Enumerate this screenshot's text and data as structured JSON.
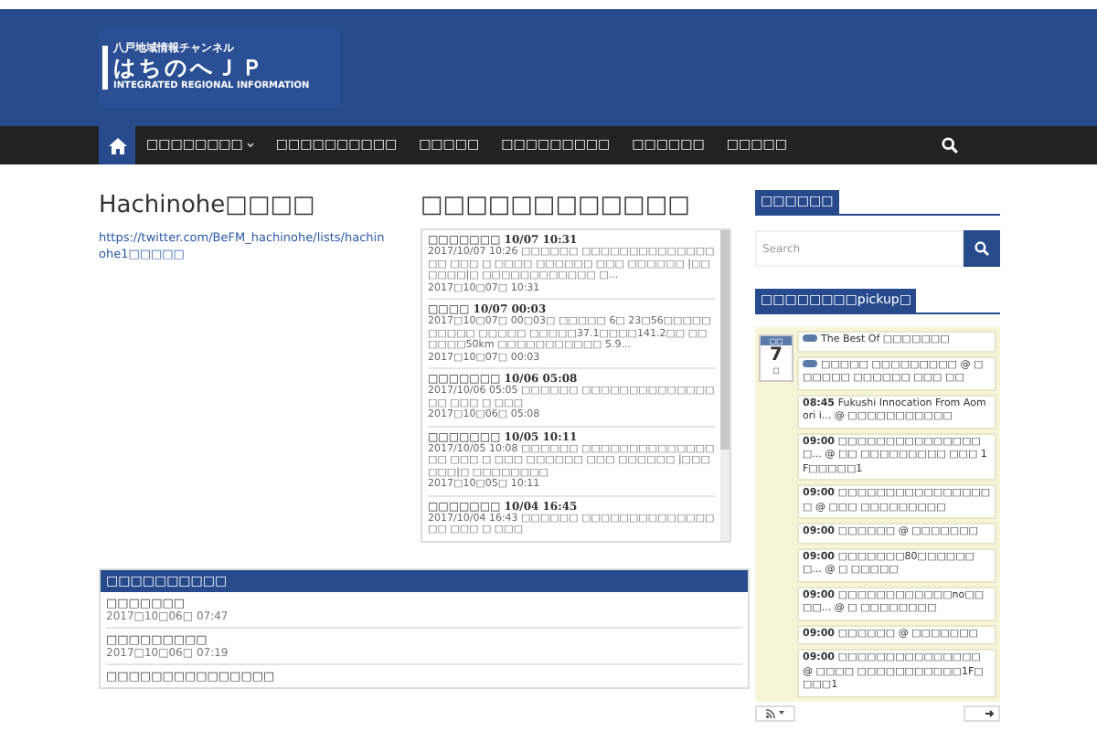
{
  "logo": {
    "tagline": "八戸地域情報チャンネル",
    "name": "はちのへＪＰ",
    "subtitle": "INTEGRATED REGIONAL INFORMATION"
  },
  "nav": {
    "items": [
      {
        "label": "□□□□□□□□",
        "has_submenu": true
      },
      {
        "label": "□□□□□□□□□□",
        "has_submenu": false
      },
      {
        "label": "□□□□□",
        "has_submenu": false
      },
      {
        "label": "□□□□□□□□□",
        "has_submenu": false
      },
      {
        "label": "□□□□□□",
        "has_submenu": false
      },
      {
        "label": "□□□□□",
        "has_submenu": false
      }
    ]
  },
  "twitter": {
    "title": "Hachinohe□□□□",
    "link": "https://twitter.com/BeFM_hachinohe/lists/hachinohe1□□□□□"
  },
  "feed": {
    "title": "□□□□□□□□□□□□",
    "entries": [
      {
        "heading": "□□□□□□□ 10/07 10:31",
        "body": "2017/10/07 10:26 □□□□□□ □□□□□□□□□□□□□□□□ □□□ □ □□□□ □□□□□□ □□□ □□□□□□ |□□□□□□|□ □□□□□□□□□□□□ □...",
        "date": "2017□10□07□ 10:31"
      },
      {
        "heading": "□□□□ 10/07 00:03",
        "body": "2017□10□07□ 00□03□ □□□□□ 6□ 23□56□□□□□□□□□□ □□□□□ □□□□□37.1□□□□141.2□□ □□□□□□50km □□□□□□□□□□□ 5.9...",
        "date": "2017□10□07□ 00:03"
      },
      {
        "heading": "□□□□□□□ 10/06 05:08",
        "body": "2017/10/06 05:05 □□□□□□ □□□□□□□□□□□□□□□□ □□□ □ □□□",
        "date": "2017□10□06□ 05:08"
      },
      {
        "heading": "□□□□□□□ 10/05 10:11",
        "body": "2017/10/05 10:08 □□□□□□ □□□□□□□□□□□□□□□□ □□□ □ □□□ □□□□□□ □□□ □□□□□□ |□□□□□□|□ □□□□□□□□",
        "date": "2017□10□05□ 10:11"
      },
      {
        "heading": "□□□□□□□ 10/04 16:45",
        "body": "2017/10/04 16:43 □□□□□□ □□□□□□□□□□□□□□□□ □□□ □ □□□"
      }
    ]
  },
  "news": {
    "title": "□□□□□□□□□□",
    "items": [
      {
        "title": "□□□□□□□",
        "date": "2017□10□06□ 07:47"
      },
      {
        "title": "□□□□□□□□□",
        "date": "2017□10□06□ 07:19"
      },
      {
        "title": "□□□□□□□□□□□□□□□"
      }
    ]
  },
  "search": {
    "title": "□□□□□□",
    "placeholder": "Search"
  },
  "calendar": {
    "title": "□□□□□□□□pickup□",
    "date": {
      "month": "□□",
      "day": "7",
      "weekday": "□"
    },
    "events": [
      {
        "kind": "allday",
        "text": "The Best Of □□□□□□□"
      },
      {
        "kind": "allday",
        "text": "□□□□□ □□□□□□□□□ @ □□□□□□ □□□□□□ □□□ □□"
      },
      {
        "kind": "timed",
        "time": "08:45",
        "text": "Fukushi Innocation From Aomori i... @ □□□□□□□□□□□"
      },
      {
        "kind": "timed",
        "time": "09:00",
        "text": "□□□□□□□□□□□□□□□□... @ □□ □□□□□□□□□ □□□ 1F□□□□□1"
      },
      {
        "kind": "timed",
        "time": "09:00",
        "text": "□□□□□□□□□□□□□□□□□ @ □□□ □□□□□□□□□"
      },
      {
        "kind": "timed",
        "time": "09:00",
        "text": "□□□□□□ @ □□□□□□□"
      },
      {
        "kind": "timed",
        "time": "09:00",
        "text": "□□□□□□□80□□□□□□□... @ □ □□□□□"
      },
      {
        "kind": "timed",
        "time": "09:00",
        "text": "□□□□□□□□□□□□no□□□□... @ □ □□□□□□□□"
      },
      {
        "kind": "timed",
        "time": "09:00",
        "text": "□□□□□□ @ □□□□□□□"
      },
      {
        "kind": "timed",
        "time": "09:00",
        "text": "□□□□□□□□□□□□□□□ @ □□□□ □□□□□□□□□□□1F□□□□1"
      }
    ]
  }
}
